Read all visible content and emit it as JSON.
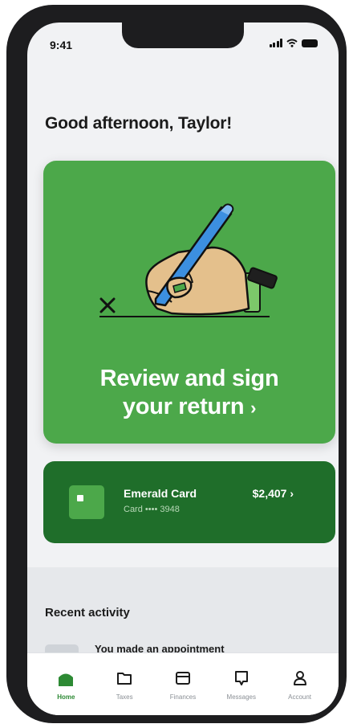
{
  "status_bar": {
    "time": "9:41"
  },
  "greeting": "Good afternoon, Taylor!",
  "hero": {
    "title_line1": "Review and sign",
    "title_line2": "your return",
    "chevron": "›"
  },
  "emerald_card": {
    "name": "Emerald Card",
    "number": "Card •••• 3948",
    "balance": "$2,407 ›"
  },
  "recent": {
    "title": "Recent activity",
    "items": [
      {
        "text": "You made an appointment"
      }
    ]
  },
  "tabs": [
    {
      "label": "Home",
      "icon": "home-icon",
      "active": true
    },
    {
      "label": "Taxes",
      "icon": "folder-icon"
    },
    {
      "label": "Finances",
      "icon": "wallet-icon"
    },
    {
      "label": "Messages",
      "icon": "message-icon"
    },
    {
      "label": "Account",
      "icon": "person-icon"
    }
  ],
  "colors": {
    "brand_green": "#4ca84a",
    "dark_green": "#1f6e2a",
    "accent_blue": "#3c8fe0"
  }
}
